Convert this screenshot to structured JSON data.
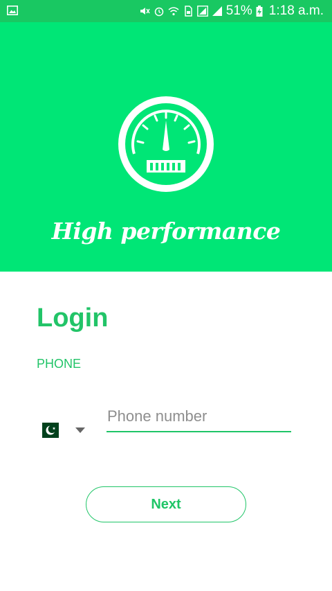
{
  "status_bar": {
    "battery": "51%",
    "time": "1:18 a.m.",
    "icons": [
      "image-icon",
      "mute-icon",
      "alarm-icon",
      "wifi-icon",
      "sim-icon",
      "signal-icon",
      "signal-icon",
      "battery-icon"
    ]
  },
  "hero": {
    "title": "High performance",
    "logo_icon": "speedometer-icon",
    "background": "#00e676"
  },
  "login": {
    "title": "Login",
    "phone_label": "PHONE",
    "phone_placeholder": "Phone number",
    "country_flag": "pakistan-flag",
    "next_label": "Next",
    "accent": "#1fc567"
  }
}
